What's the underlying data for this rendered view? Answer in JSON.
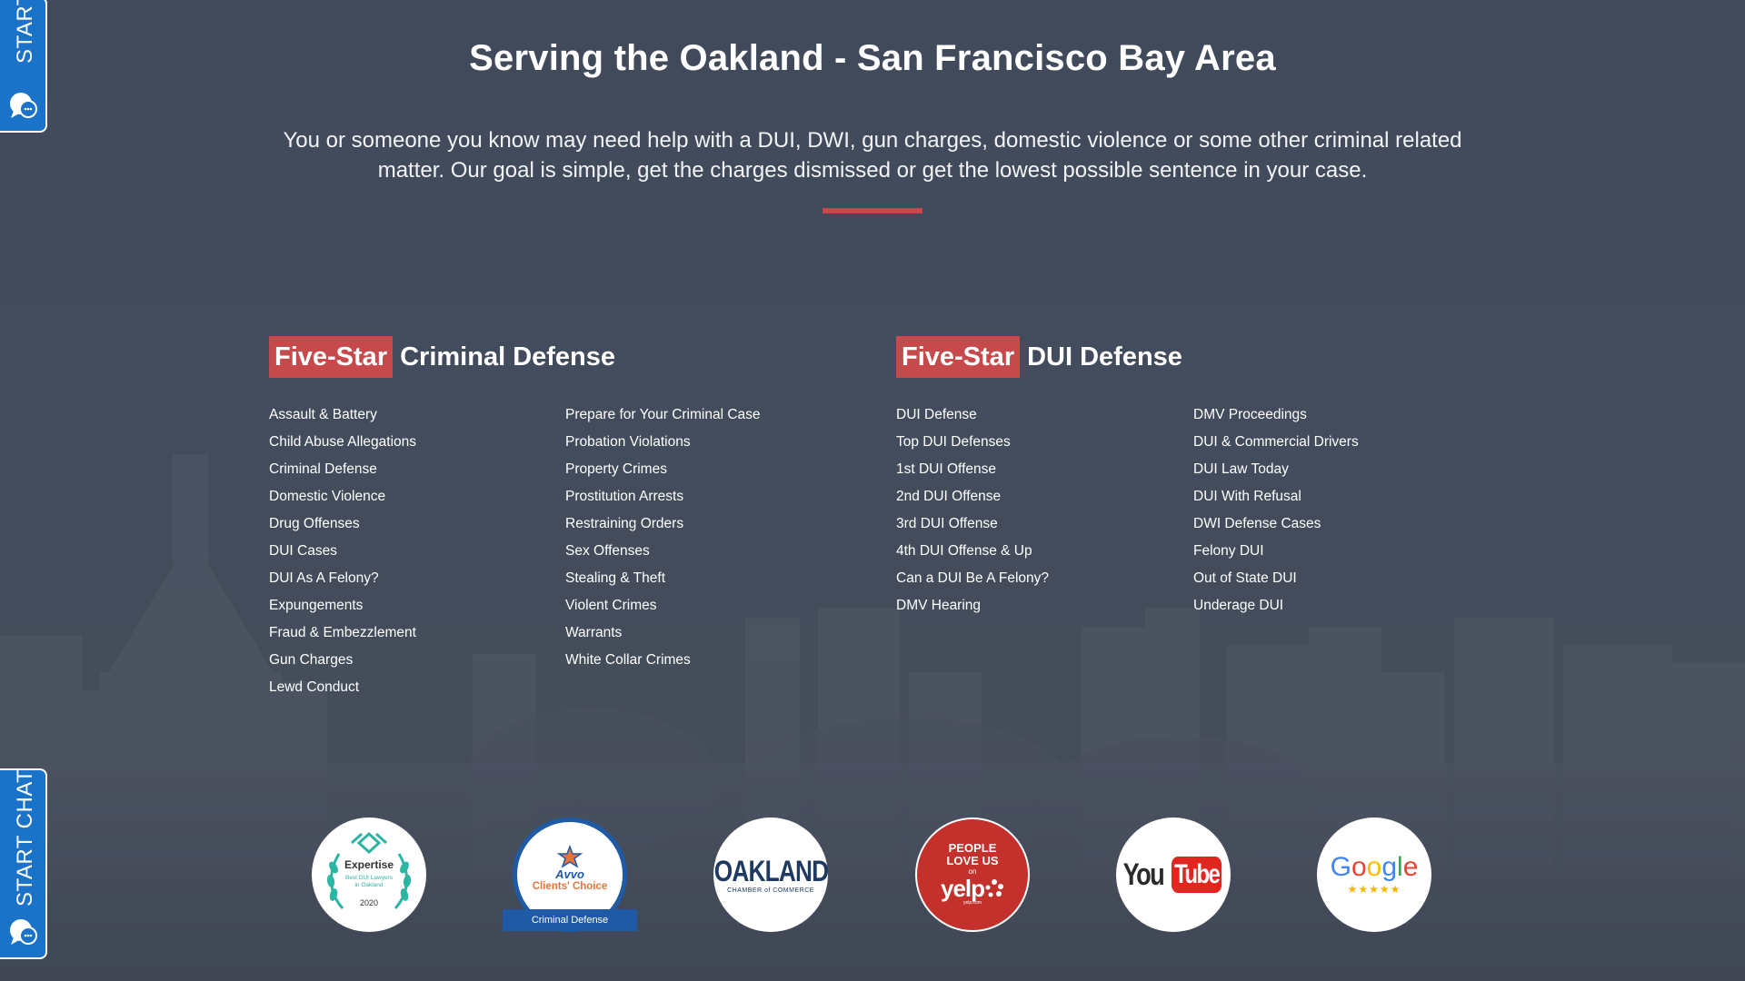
{
  "heading": "Serving the Oakland - San Francisco Bay Area",
  "intro": "You or someone you know may need help with a DUI, DWI, gun charges, domestic violence or some other criminal related matter. Our goal is simple, get the charges dismissed or get the lowest possible sentence in your case.",
  "colors": {
    "accent": "#c64a4c",
    "background": "#414a5a",
    "chat": "#1a73c9"
  },
  "criminal": {
    "tag": "Five-Star",
    "title": "Criminal Defense",
    "col1": [
      "Assault & Battery",
      "Child Abuse Allegations",
      "Criminal Defense",
      "Domestic Violence",
      "Drug Offenses",
      "DUI Cases",
      "DUI As A Felony?",
      "Expungements",
      "Fraud & Embezzlement",
      "Gun Charges",
      "Lewd Conduct"
    ],
    "col2": [
      "Prepare for Your Criminal Case",
      "Probation Violations",
      "Property Crimes",
      "Prostitution Arrests",
      "Restraining Orders",
      "Sex Offenses",
      "Stealing & Theft",
      "Violent Crimes",
      "Warrants",
      "White Collar Crimes"
    ]
  },
  "dui": {
    "tag": "Five-Star",
    "title": "DUI Defense",
    "col1": [
      "DUI Defense",
      "Top DUI Defenses",
      "1st DUI Offense",
      "2nd DUI Offense",
      "3rd DUI Offense",
      "4th DUI Offense & Up",
      "Can a DUI Be A Felony?",
      "DMV Hearing"
    ],
    "col2": [
      "DMV Proceedings",
      "DUI & Commercial Drivers",
      "DUI Law Today",
      "DUI With Refusal",
      "DWI Defense Cases",
      "Felony DUI",
      "Out of State DUI",
      "Underage DUI"
    ]
  },
  "badges": {
    "expertise": {
      "title": "Expertise",
      "line1": "Best DUI Lawyers",
      "line2": "in Oakland",
      "year": "2020"
    },
    "avvo": {
      "brand": "Avvo",
      "title": "Clients' Choice",
      "ribbon": "Criminal Defense"
    },
    "oakland": {
      "title": "OAKLAND",
      "sub": "CHAMBER of COMMERCE"
    },
    "yelp": {
      "line1": "PEOPLE",
      "line2": "LOVE US",
      "line3": "on",
      "brand": "yelp",
      "url": "yelp.com"
    },
    "youtube": {
      "you": "You",
      "tube": "Tube"
    },
    "google": {
      "brand": "Google",
      "stars": "★★★★★"
    }
  },
  "chat": {
    "label": "START CHAT",
    "label_top": "START C"
  }
}
